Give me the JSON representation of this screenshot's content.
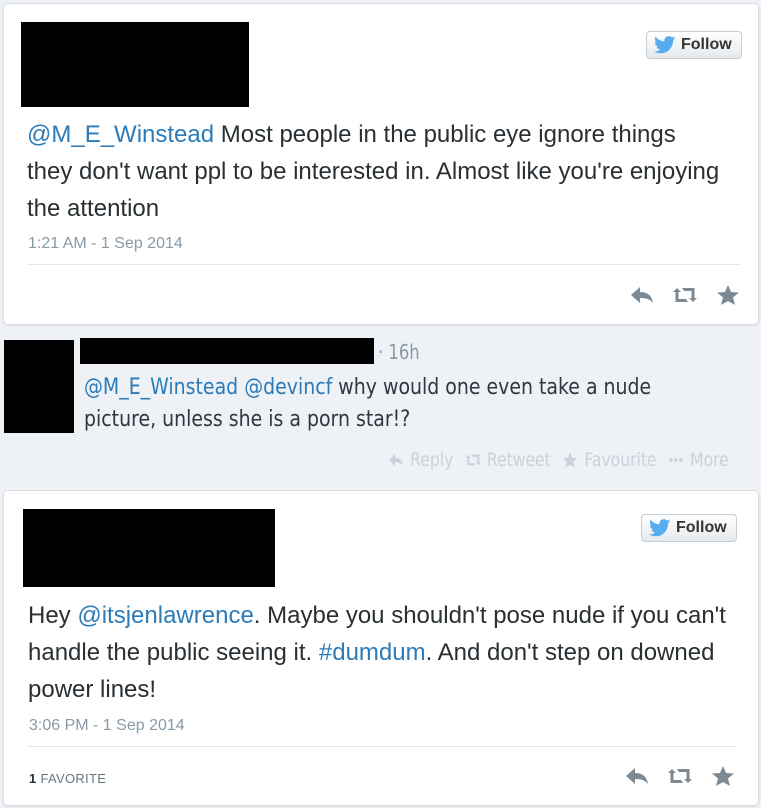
{
  "tweet1": {
    "follow_label": "Follow",
    "mention": "@M_E_Winstead",
    "text": " Most people in the public eye ignore things they don't want ppl to be interested in. Almost like you're enjoying the attention",
    "timestamp": "1:21 AM - 1 Sep 2014",
    "actions": [
      "reply-icon",
      "retweet-icon",
      "favorite-icon"
    ]
  },
  "tweet2": {
    "time": "· 16h",
    "mention1": "@M_E_Winstead",
    "mention2": "@devincf",
    "text": " why would one even take a nude picture, unless she is a porn star!?",
    "actions": {
      "reply": "Reply",
      "retweet": "Retweet",
      "favourite": "Favourite",
      "more": "More"
    }
  },
  "tweet3": {
    "follow_label": "Follow",
    "text_prefix": "Hey ",
    "mention": "@itsjenlawrence",
    "text_mid": ". Maybe you shouldn't pose nude if you can't handle the public seeing it. ",
    "hashtag": "#dumdum",
    "text_end": ". And don't step on downed power lines!",
    "timestamp": "3:06 PM - 1 Sep 2014",
    "favorite_count": "1",
    "favorite_label": "FAVORITE"
  }
}
